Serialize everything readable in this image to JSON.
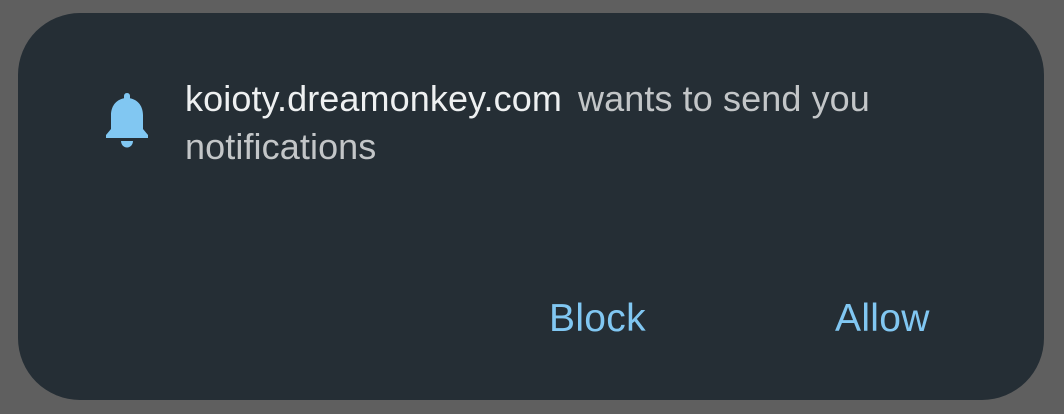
{
  "prompt": {
    "origin": "koioty.dreamonkey.com",
    "message": "wants to send you notifications",
    "icon": "bell-icon"
  },
  "actions": {
    "block_label": "Block",
    "allow_label": "Allow"
  },
  "colors": {
    "overlay": "#5f5f5f",
    "dialog_background": "#252e35",
    "accent": "#81c7f2",
    "origin_text": "#eef0f1",
    "message_text": "#c3c6c8"
  }
}
